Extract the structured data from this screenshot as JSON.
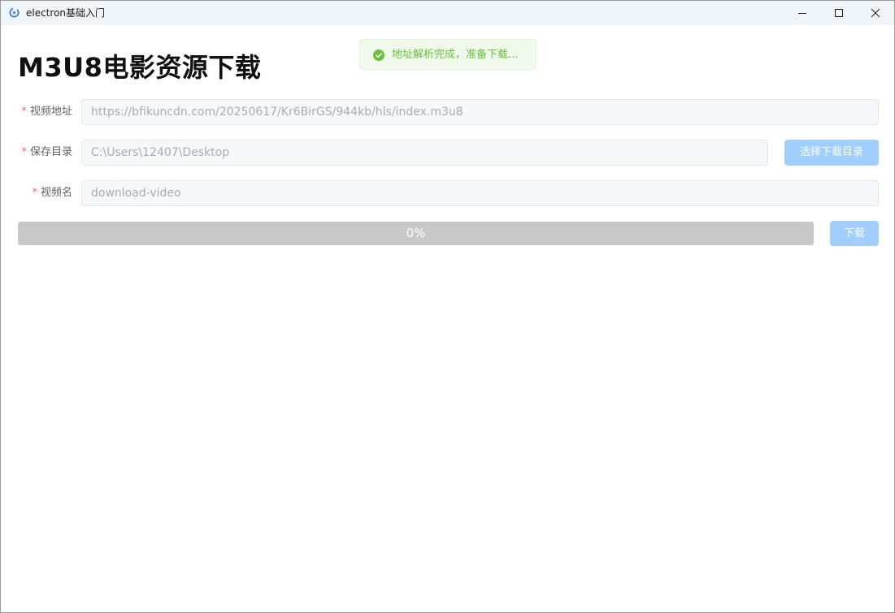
{
  "window": {
    "title": "electron基础入门",
    "icon": "electron-app-icon",
    "controls": {
      "minimize": "minimize-icon",
      "maximize": "maximize-icon",
      "close": "close-icon"
    }
  },
  "page": {
    "title": "M3U8电影资源下载"
  },
  "toast": {
    "icon": "check-circle-icon",
    "text": "地址解析完成，准备下载...",
    "color": "#67c23a"
  },
  "form": {
    "required_mark": "*",
    "video_url": {
      "label": "视频地址",
      "value": "https://bfikuncdn.com/20250617/Kr6BirGS/944kb/hls/index.m3u8"
    },
    "save_dir": {
      "label": "保存目录",
      "value": "C:\\Users\\12407\\Desktop",
      "button_label": "选择下载目录"
    },
    "video_name": {
      "label": "视频名",
      "value": "download-video"
    }
  },
  "progress": {
    "percent": 0,
    "text": "0%"
  },
  "download_button": {
    "label": "下载"
  },
  "colors": {
    "accent_disabled": "#a0cfff",
    "required": "#f56c6c",
    "titlebar": "#eff4f9"
  }
}
